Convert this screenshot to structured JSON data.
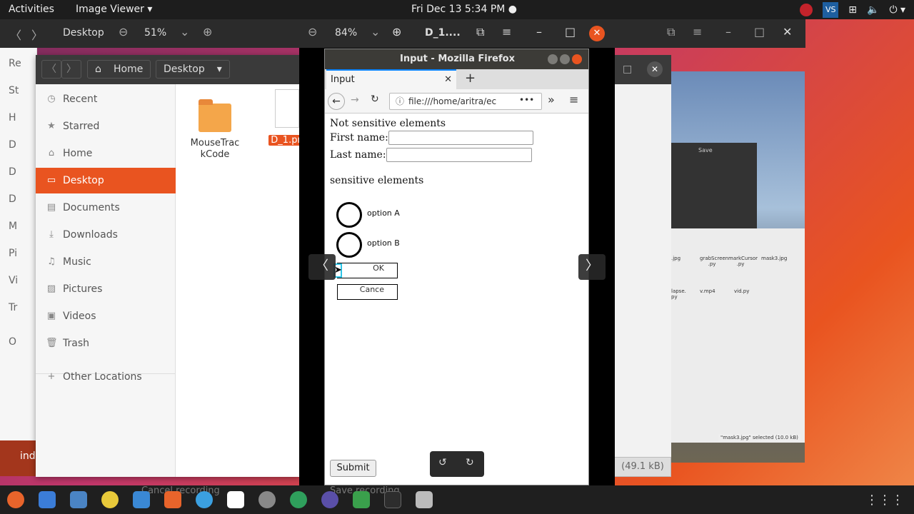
{
  "topbar": {
    "activities": "Activities",
    "app_menu": "Image Viewer ▾",
    "clock": "Fri Dec 13  5:34 PM ●"
  },
  "bg_viewer": {
    "zoom": "51%"
  },
  "files": {
    "breadcrumb_home": "Home",
    "breadcrumb_desktop": "Desktop",
    "sidebar": [
      {
        "label": "Recent",
        "icon": "clock-icon"
      },
      {
        "label": "Starred",
        "icon": "star-icon"
      },
      {
        "label": "Home",
        "icon": "home-icon"
      },
      {
        "label": "Desktop",
        "icon": "desktop-icon"
      },
      {
        "label": "Documents",
        "icon": "document-icon"
      },
      {
        "label": "Downloads",
        "icon": "download-icon"
      },
      {
        "label": "Music",
        "icon": "music-icon"
      },
      {
        "label": "Pictures",
        "icon": "picture-icon"
      },
      {
        "label": "Videos",
        "icon": "video-icon"
      },
      {
        "label": "Trash",
        "icon": "trash-icon"
      }
    ],
    "other_locations": "Other Locations",
    "items": [
      {
        "name": "MouseTrac kCode"
      },
      {
        "name": "D_1.pn"
      }
    ],
    "leftstrip": [
      "Re",
      "St",
      "H",
      "D",
      "D",
      "D",
      "M",
      "Pi",
      "Vi",
      "Tr",
      "O"
    ],
    "left_bottom_text": "ind"
  },
  "viewer": {
    "zoom": "84%",
    "title": "D_1....",
    "firefox": {
      "window_title": "Input - Mozilla Firefox",
      "tab_title": "Input",
      "url": "file:///home/aritra/ec",
      "page": {
        "heading1": "Not sensitive elements",
        "first_name_label": "First name:",
        "last_name_label": "Last name:",
        "heading2": "sensitive elements",
        "option_a": "option A",
        "option_b": "option B",
        "ok": "OK",
        "cancel": "Cance",
        "submit": "Submit"
      }
    }
  },
  "right_window": {
    "status": "(49.1 kB)"
  },
  "right_desktop": {
    "save": "Save",
    "selected": "\"mask3.jpg\" selected (10.0 kB)",
    "files": [
      ".jpg",
      "grabScreen .py",
      "markCursor .py",
      "mask3.jpg",
      "lapse. py",
      "v.mp4",
      "vid.py"
    ]
  },
  "dock": {
    "ghost1": "Cancel recording",
    "ghost2": "Save recording"
  },
  "colors": {
    "accent": "#e95420",
    "topbar": "#1d1d1d",
    "dock": "#1f1f1f"
  }
}
